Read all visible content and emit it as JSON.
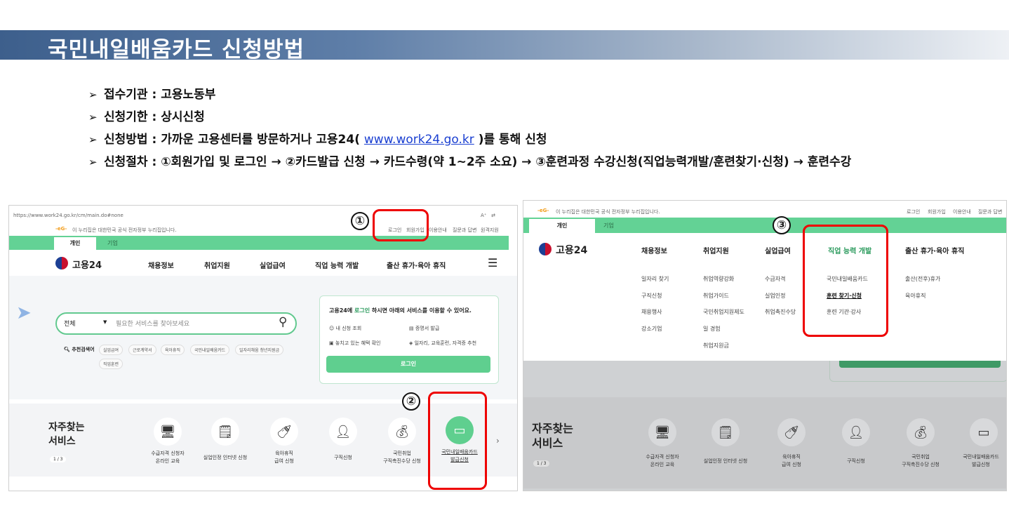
{
  "slide": {
    "title": "국민내일배움카드  신청방법",
    "bullets": [
      {
        "label": "접수기관 : 고용노동부"
      },
      {
        "label": "신청기한 : 상시신청"
      },
      {
        "prefix": "신청방법 : 가까운 고용센터를 방문하거나 고용24( ",
        "link": "www.work24.go.kr",
        "suffix": " )를 통해 신청"
      },
      {
        "label": "신청절차 : ①회원가입 및 로그인 → ②카드발급 신청 → 카드수령(약 1~2주 소요) → ③훈련과정 수강신청(직업능력개발/훈련찾기·신청) → 훈련수강"
      }
    ],
    "arrow": "➢"
  },
  "left_shot": {
    "url": "https://www.work24.go.kr/cm/main.do#none",
    "gov_notice": "이 누리집은 대한민국 공식 전자정부 누리집입니다.",
    "top_links": [
      "로그인",
      "회원가입",
      "이용안내",
      "질문과 답변",
      "원격지원"
    ],
    "tabs": [
      "개인",
      "기업"
    ],
    "logo": "고용24",
    "nav": [
      "채용정보",
      "취업지원",
      "실업급여",
      "직업 능력 개발",
      "출산 휴가·육아 휴직"
    ],
    "search": {
      "scope": "전체",
      "placeholder": "필요한 서비스를 찾아보세요"
    },
    "recommend_label": "추천검색어",
    "chips": [
      "실업급여",
      "근로계약서",
      "육아휴직",
      "국민내일배움카드",
      "일자리채움 청년지원금",
      "직업훈련"
    ],
    "panel": {
      "heading_pre": "고용24에 ",
      "heading_link": "로그인",
      "heading_post": " 하시면 아래의 서비스를 이용할 수 있어요.",
      "items": [
        "내 신청 조회",
        "증명서 발급",
        "놓치고 있는 혜택 확인",
        "일자리, 교육훈련, 자격증 추천"
      ],
      "button": "로그인"
    },
    "services_title": [
      "자주찾는",
      "서비스"
    ],
    "page": "1 / 3",
    "services": [
      {
        "l1": "수급자격 신청자",
        "l2": "온라인 교육"
      },
      {
        "l1": "실업인정 인터넷 신청",
        "l2": ""
      },
      {
        "l1": "육아휴직",
        "l2": "급여 신청"
      },
      {
        "l1": "구직신청",
        "l2": ""
      },
      {
        "l1": "국민취업",
        "l2": "구직촉진수당 신청"
      },
      {
        "l1": "국민내일배움카드",
        "l2": "발급신청"
      }
    ]
  },
  "right_shot": {
    "gov_notice": "이 누리집은 대한민국 공식 전자정부 누리집입니다.",
    "top_links": [
      "로그인",
      "회원가입",
      "이용안내",
      "질문과 답변"
    ],
    "tabs": [
      "개인",
      "기업"
    ],
    "logo": "고용24",
    "nav": [
      "채용정보",
      "취업지원",
      "실업급여",
      "직업 능력 개발",
      "출산 휴가·육아 휴직"
    ],
    "menu": [
      [
        "일자리 찾기",
        "구직신청",
        "채용행사",
        "강소기업"
      ],
      [
        "취업역량강화",
        "취업가이드",
        "국민취업지원제도",
        "일 경험",
        "취업지원금"
      ],
      [
        "수급자격",
        "실업인정",
        "취업촉진수당"
      ],
      [
        "국민내일배움카드",
        "훈련 찾기·신청",
        "훈련 기관·강사"
      ],
      [
        "출산(전후)휴가",
        "육아휴직"
      ]
    ],
    "services_title": [
      "자주찾는",
      "서비스"
    ],
    "page": "1 / 3",
    "services": [
      {
        "l1": "수급자격 신청자",
        "l2": "온라인 교육"
      },
      {
        "l1": "실업인정 인터넷 신청",
        "l2": ""
      },
      {
        "l1": "육아휴직",
        "l2": "급여 신청"
      },
      {
        "l1": "구직신청",
        "l2": ""
      },
      {
        "l1": "국민취업",
        "l2": "구직촉진수당 신청"
      },
      {
        "l1": "국민내일배움카드",
        "l2": "발급신청"
      }
    ]
  },
  "markers": [
    "①",
    "②",
    "③"
  ],
  "colors": {
    "accent_green": "#63d295",
    "highlight_red": "#e00000",
    "banner_blue": "#3d5f8c"
  }
}
